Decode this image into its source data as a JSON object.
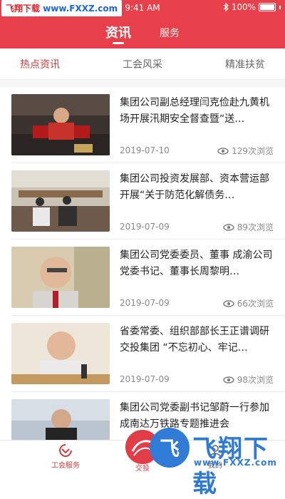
{
  "status_bar": {
    "watermark_left_red": "飞翔下载",
    "watermark_left_blue": "www.FXXZ.com",
    "time": "9:41 AM",
    "battery": "100%"
  },
  "top_tabs": [
    {
      "label": "资讯",
      "active": true
    },
    {
      "label": "服务",
      "active": false
    }
  ],
  "sub_tabs": [
    {
      "label": "热点资讯",
      "active": true
    },
    {
      "label": "工会风采",
      "active": false
    },
    {
      "label": "精准扶贫",
      "active": false
    }
  ],
  "news": [
    {
      "title": "集团公司副总经理闫克俭赴九黄机场开展汛期安全督查暨“送…",
      "date": "2019-07-10",
      "views": "129次浏览",
      "image": "meeting-speaker-photo"
    },
    {
      "title": "集团公司投资发展部、资本营运部开展“关于防范化解债务…",
      "date": "2019-07-09",
      "views": "89次浏览",
      "image": "conference-room-photo"
    },
    {
      "title": "集团公司党委委员、董事 成渝公司党委书记、董事长周黎明…",
      "date": "2019-07-09",
      "views": "66次浏览",
      "image": "portrait-photo"
    },
    {
      "title": "省委常委、组织部部长王正谱调研交投集团 “不忘初心、牢记…",
      "date": "2019-07-09",
      "views": "98次浏览",
      "image": "official-speaking-photo"
    },
    {
      "title": "集团公司党委副书记邹蔚一行参加成南达万铁路专题推进会",
      "date": "",
      "views": "",
      "image": "meeting-photo"
    }
  ],
  "bottom_nav": [
    {
      "label": "工会服务"
    },
    {
      "label": "交投"
    },
    {
      "label": "我的"
    }
  ],
  "watermark_bottom": {
    "logo_char": "飞",
    "big_text": "飞翔下载",
    "small_text": "www.FXXZ.com"
  },
  "colors": {
    "accent": "#e8404a",
    "active_tab": "#d53a3a",
    "watermark_blue": "#2e7ad3"
  }
}
